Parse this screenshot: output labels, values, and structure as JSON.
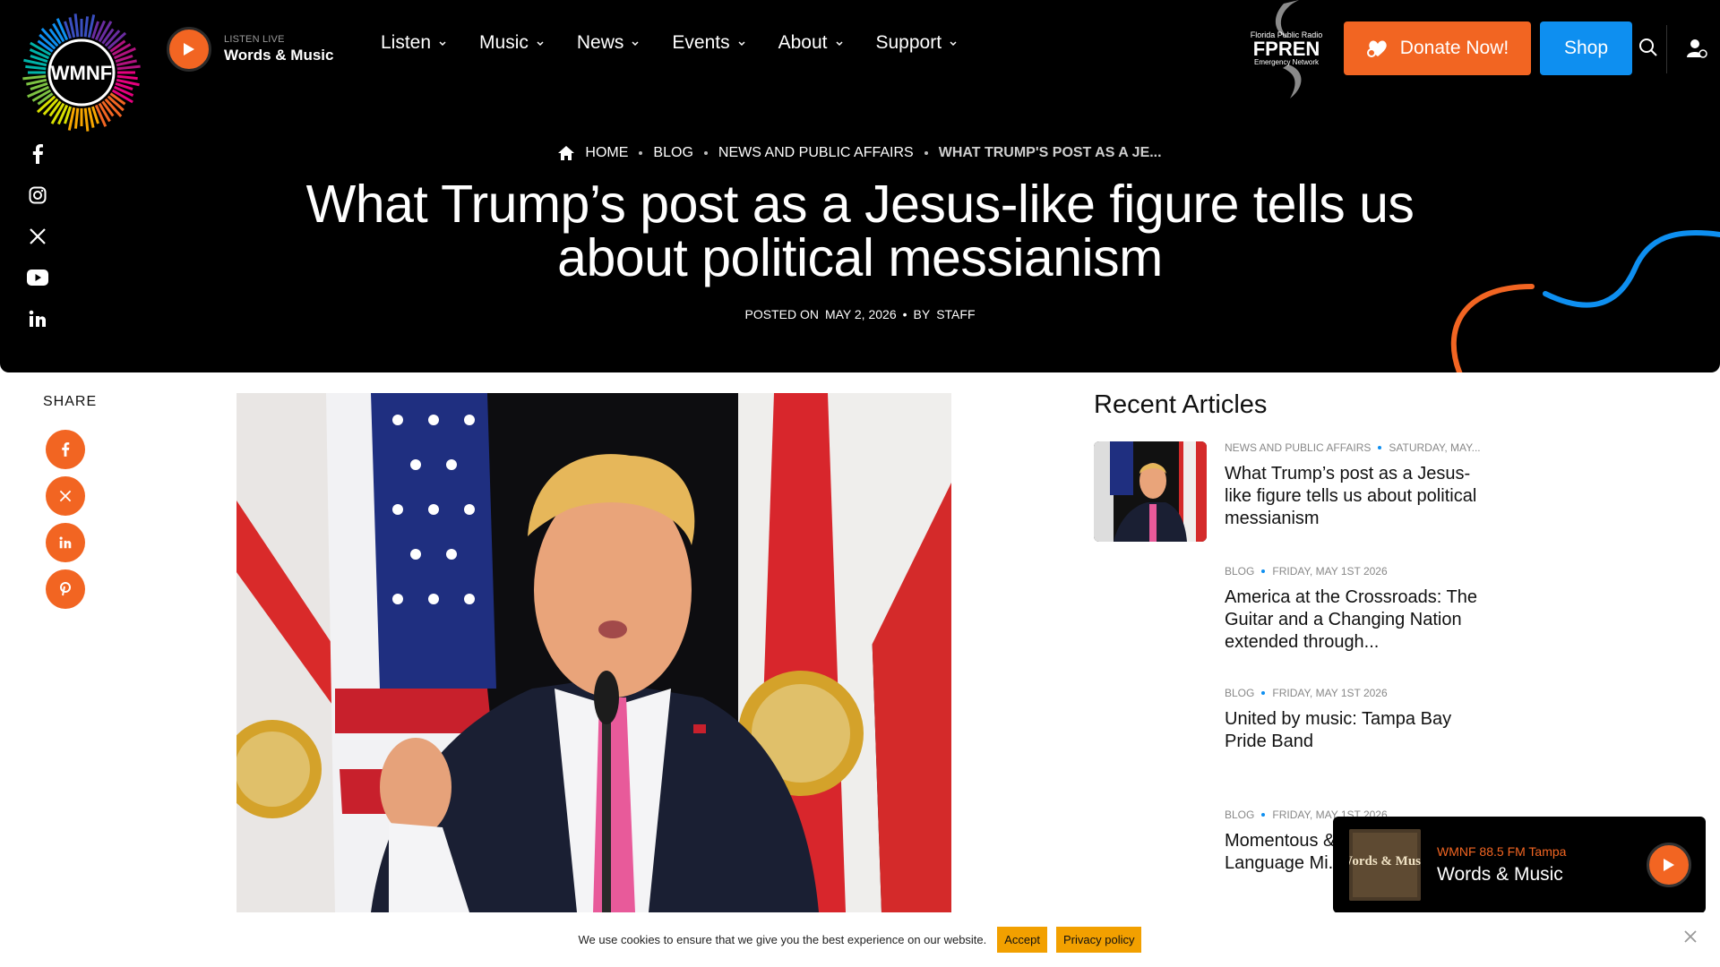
{
  "header": {
    "logo_text": "WMNF",
    "listen_live": {
      "label": "LISTEN LIVE",
      "show": "Words & Music"
    },
    "nav": [
      {
        "label": "Listen"
      },
      {
        "label": "Music"
      },
      {
        "label": "News"
      },
      {
        "label": "Events"
      },
      {
        "label": "About"
      },
      {
        "label": "Support"
      }
    ],
    "partner_logo": {
      "line1": "Florida Public Radio",
      "line2": "FPREN",
      "line3": "Emergency Network"
    },
    "donate_label": "Donate Now!",
    "shop_label": "Shop"
  },
  "social": [
    "facebook-icon",
    "instagram-icon",
    "x-icon",
    "youtube-icon",
    "linkedin-icon"
  ],
  "breadcrumb": {
    "items": [
      "HOME",
      "BLOG",
      "NEWS AND PUBLIC AFFAIRS"
    ],
    "current": "WHAT TRUMP'S POST AS A JE..."
  },
  "article": {
    "title": "What Trump’s post as a Jesus-like figure tells us about political messianism",
    "posted_prefix": "POSTED ON",
    "date": "MAY 2, 2026",
    "by_prefix": "BY",
    "author": "STAFF"
  },
  "share": {
    "label": "SHARE",
    "buttons": [
      "facebook-icon",
      "x-icon",
      "linkedin-icon",
      "pinterest-icon"
    ]
  },
  "recent": {
    "title": "Recent Articles",
    "articles": [
      {
        "category": "NEWS AND PUBLIC AFFAIRS",
        "date": "SATURDAY, MAY...",
        "headline": "What Trump’s post as a Jesus-like figure tells us about political messianism"
      },
      {
        "category": "BLOG",
        "date": "FRIDAY, MAY 1ST 2026",
        "headline": "America at the Crossroads: The Guitar and a Changing Nation extended through..."
      },
      {
        "category": "BLOG",
        "date": "FRIDAY, MAY 1ST 2026",
        "headline": "United by music: Tampa Bay Pride Band"
      },
      {
        "category": "BLOG",
        "date": "FRIDAY, MAY 1ST 2026",
        "headline": "Momentous & Questions. A Language Mi..."
      }
    ]
  },
  "player": {
    "art_text": "Words & Music",
    "station": "WMNF 88.5 FM Tampa",
    "show": "Words & Music"
  },
  "cookie": {
    "message": "We use cookies to ensure that we give you the best experience on our website.",
    "accept": "Accept",
    "privacy": "Privacy policy"
  },
  "colors": {
    "accent_orange": "#f26522",
    "accent_blue": "#0e8ff0",
    "hero_bg": "#000000",
    "cookie_btn": "#f2a000"
  }
}
